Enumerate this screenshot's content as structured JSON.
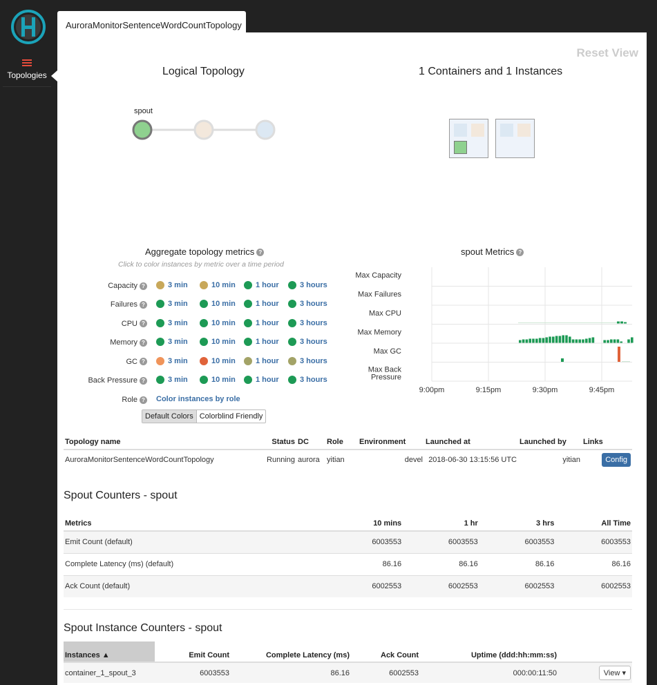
{
  "sidebar": {
    "nav_label": "Topologies"
  },
  "tab": {
    "label": "AuroraMonitorSentenceWordCountTopology"
  },
  "toolbar": {
    "reset_label": "Reset View"
  },
  "logical": {
    "title": "Logical Topology",
    "node_label": "spout"
  },
  "physical": {
    "title": "1 Containers and 1 Instances"
  },
  "aggregate": {
    "title": "Aggregate topology metrics",
    "subtitle": "Click to color instances by metric over a time period",
    "rows": [
      {
        "name": "Capacity",
        "colors": [
          "#c8a85a",
          "#c8a85a",
          "#1d9a55",
          "#1d9a55"
        ]
      },
      {
        "name": "Failures",
        "colors": [
          "#1d9a55",
          "#1d9a55",
          "#1d9a55",
          "#1d9a55"
        ]
      },
      {
        "name": "CPU",
        "colors": [
          "#1d9a55",
          "#1d9a55",
          "#1d9a55",
          "#1d9a55"
        ]
      },
      {
        "name": "Memory",
        "colors": [
          "#1d9a55",
          "#1d9a55",
          "#1d9a55",
          "#1d9a55"
        ]
      },
      {
        "name": "GC",
        "colors": [
          "#f0945a",
          "#e0633a",
          "#a3a367",
          "#a3a367"
        ]
      },
      {
        "name": "Back Pressure",
        "colors": [
          "#1d9a55",
          "#1d9a55",
          "#1d9a55",
          "#1d9a55"
        ]
      }
    ],
    "periods": [
      "3 min",
      "10 min",
      "1 hour",
      "3 hours"
    ],
    "role_label": "Role",
    "role_link": "Color instances by role",
    "btn_default": "Default Colors",
    "btn_colorblind": "Colorblind Friendly"
  },
  "spout_metrics": {
    "title": "spout Metrics",
    "row_labels": [
      "Max Capacity",
      "Max Failures",
      "Max CPU",
      "Max Memory",
      "Max GC",
      "Max Back Pressure"
    ],
    "x_ticks": [
      "9:00pm",
      "9:15pm",
      "9:30pm",
      "9:45pm"
    ]
  },
  "topology": {
    "headers": [
      "Topology name",
      "Status",
      "DC",
      "Role",
      "Environment",
      "Launched at",
      "Launched by",
      "Links"
    ],
    "row": [
      "AuroraMonitorSentenceWordCountTopology",
      "Running",
      "aurora",
      "yitian",
      "devel",
      "2018-06-30 13:15:56 UTC",
      "yitian"
    ],
    "config_label": "Config"
  },
  "spout_counters": {
    "title": "Spout Counters - spout",
    "headers": [
      "Metrics",
      "10 mins",
      "1 hr",
      "3 hrs",
      "All Time"
    ],
    "rows": [
      [
        "Emit Count (default)",
        "6003553",
        "6003553",
        "6003553",
        "6003553"
      ],
      [
        "Complete Latency (ms) (default)",
        "86.16",
        "86.16",
        "86.16",
        "86.16"
      ],
      [
        "Ack Count (default)",
        "6002553",
        "6002553",
        "6002553",
        "6002553"
      ]
    ]
  },
  "instance_counters": {
    "title": "Spout Instance Counters - spout",
    "headers": [
      "Instances ▲",
      "Emit Count",
      "Complete Latency (ms)",
      "Ack Count",
      "Uptime (ddd:hh:mm:ss)"
    ],
    "row": [
      "container_1_spout_3",
      "6003553",
      "86.16",
      "6002553",
      "000:00:11:50"
    ],
    "view_label": "View ▾"
  }
}
